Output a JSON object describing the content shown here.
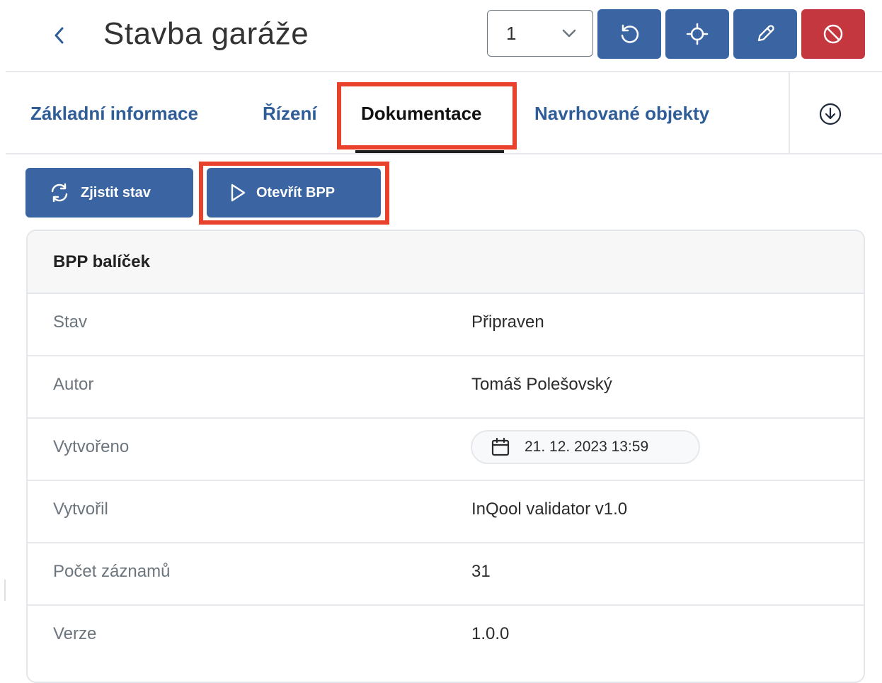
{
  "header": {
    "title": "Stavba garáže",
    "version_value": "1"
  },
  "tabs": [
    {
      "label": "Základní informace",
      "active": false
    },
    {
      "label": "Řízení",
      "active": false
    },
    {
      "label": "Dokumentace",
      "active": true
    },
    {
      "label": "Navrhované objekty",
      "active": false
    }
  ],
  "actions": {
    "check_status": "Zjistit stav",
    "open_bpp": "Otevřít BPP"
  },
  "card": {
    "title": "BPP balíček",
    "rows": [
      {
        "label": "Stav",
        "value": "Připraven"
      },
      {
        "label": "Autor",
        "value": "Tomáš Polešovský"
      },
      {
        "label": "Vytvořeno",
        "value": "21. 12. 2023 13:59"
      },
      {
        "label": "Vytvořil",
        "value": "InQool validator v1.0"
      },
      {
        "label": "Počet záznamů",
        "value": "31"
      },
      {
        "label": "Verze",
        "value": "1.0.0"
      }
    ]
  },
  "colors": {
    "primary": "#3a65a2",
    "danger": "#c4373f",
    "tab_link": "#2f5d98",
    "highlight": "#e8412c"
  },
  "icons": [
    "chevron-left-icon",
    "chevron-down-icon",
    "refresh-icon",
    "crosshair-icon",
    "pencil-icon",
    "ban-icon",
    "download-circle-icon",
    "sync-icon",
    "play-icon",
    "calendar-icon"
  ]
}
